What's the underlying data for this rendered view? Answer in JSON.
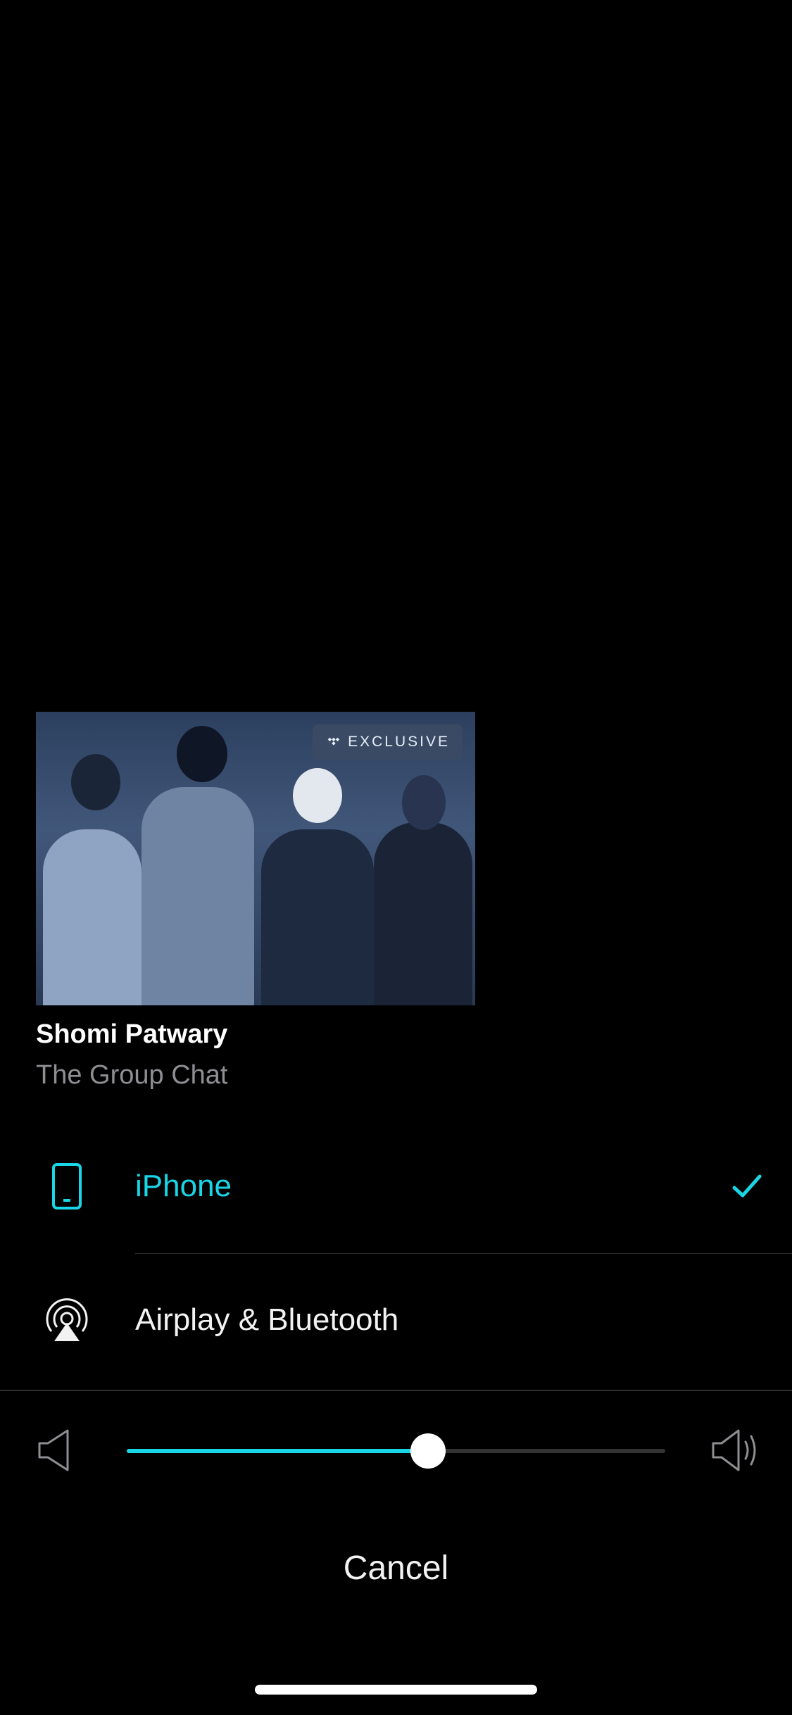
{
  "now_playing": {
    "badge": "EXCLUSIVE",
    "artist": "Shomi Patwary",
    "title": "The Group Chat"
  },
  "outputs": [
    {
      "label": "iPhone",
      "icon": "phone-icon",
      "selected": true
    },
    {
      "label": "Airplay & Bluetooth",
      "icon": "airplay-icon",
      "selected": false
    }
  ],
  "volume": {
    "level": 0.56
  },
  "actions": {
    "cancel_label": "Cancel"
  },
  "colors": {
    "accent": "#19d6e6",
    "background": "#000000",
    "secondary_text": "#8e8e93"
  }
}
